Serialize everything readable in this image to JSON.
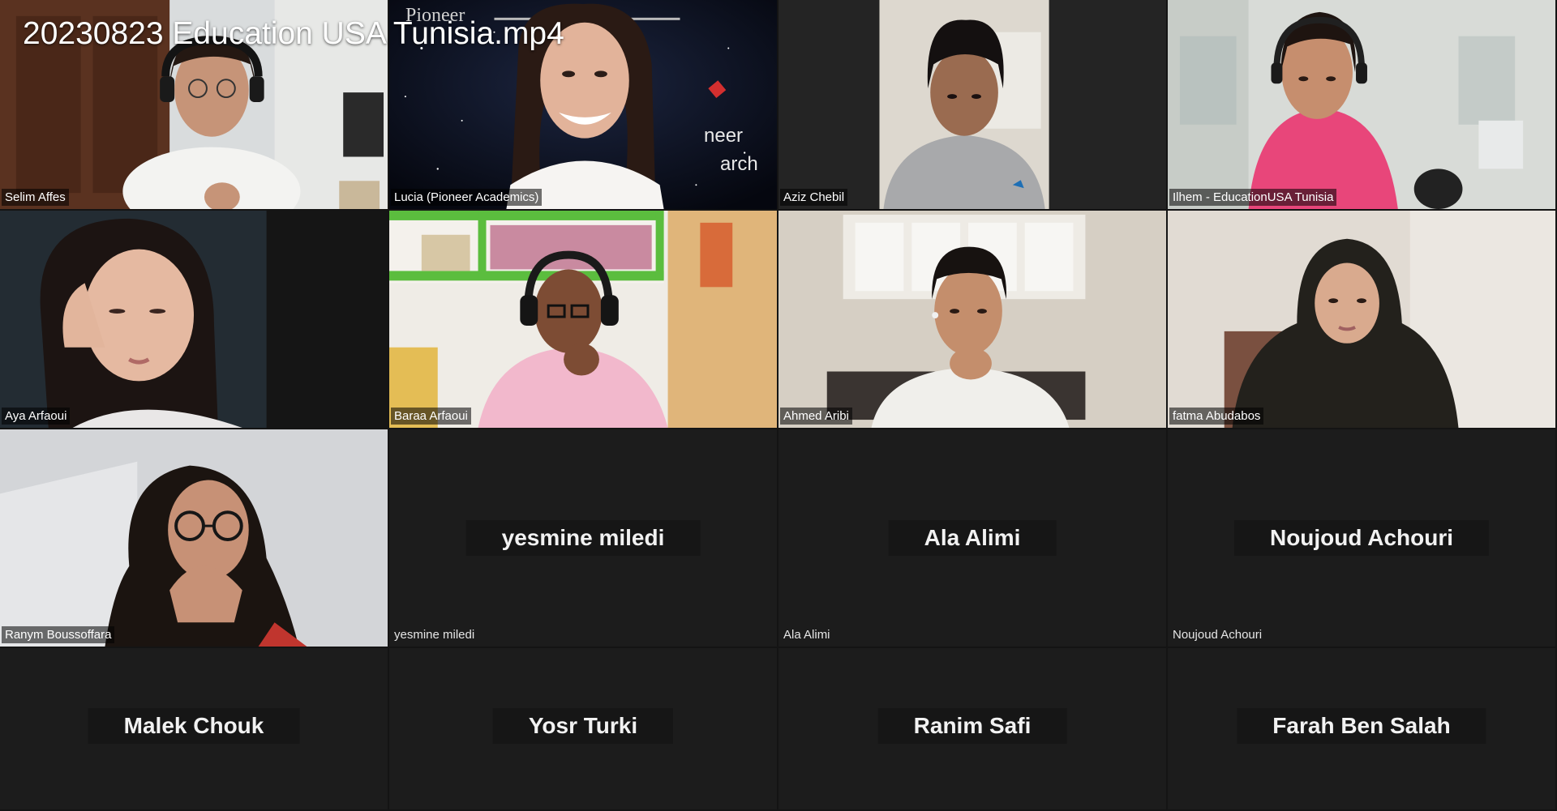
{
  "video": {
    "title": "20230823 Education USA Tunisia.mp4"
  },
  "participants": [
    {
      "name": "Selim Affes",
      "video": true
    },
    {
      "name": "Lucia (Pioneer Academics)",
      "video": true,
      "backdrop_text": [
        "Pioneer",
        "neer",
        "arch"
      ]
    },
    {
      "name": "Aziz Chebil",
      "video": true
    },
    {
      "name": "Ilhem - EducationUSA Tunisia",
      "video": true
    },
    {
      "name": "Aya Arfaoui",
      "video": true
    },
    {
      "name": "Baraa Arfaoui",
      "video": true
    },
    {
      "name": "Ahmed Aribi",
      "video": true
    },
    {
      "name": "fatma Abudabos",
      "video": true
    },
    {
      "name": "Ranym Boussoffara",
      "video": true
    },
    {
      "name": "yesmine miledi",
      "video": false
    },
    {
      "name": "Ala Alimi",
      "video": false
    },
    {
      "name": "Noujoud Achouri",
      "video": false
    },
    {
      "name": "Malek Chouk",
      "video": false
    },
    {
      "name": "Yosr Turki",
      "video": false
    },
    {
      "name": "Ranim Safi",
      "video": false
    },
    {
      "name": "Farah Ben Salah",
      "video": false
    }
  ],
  "colors": {
    "tile_bg": "#1c1c1c",
    "name_box_bg": "#161616",
    "name_text": "#f2f2f2",
    "accent_red": "#d32f2f"
  }
}
